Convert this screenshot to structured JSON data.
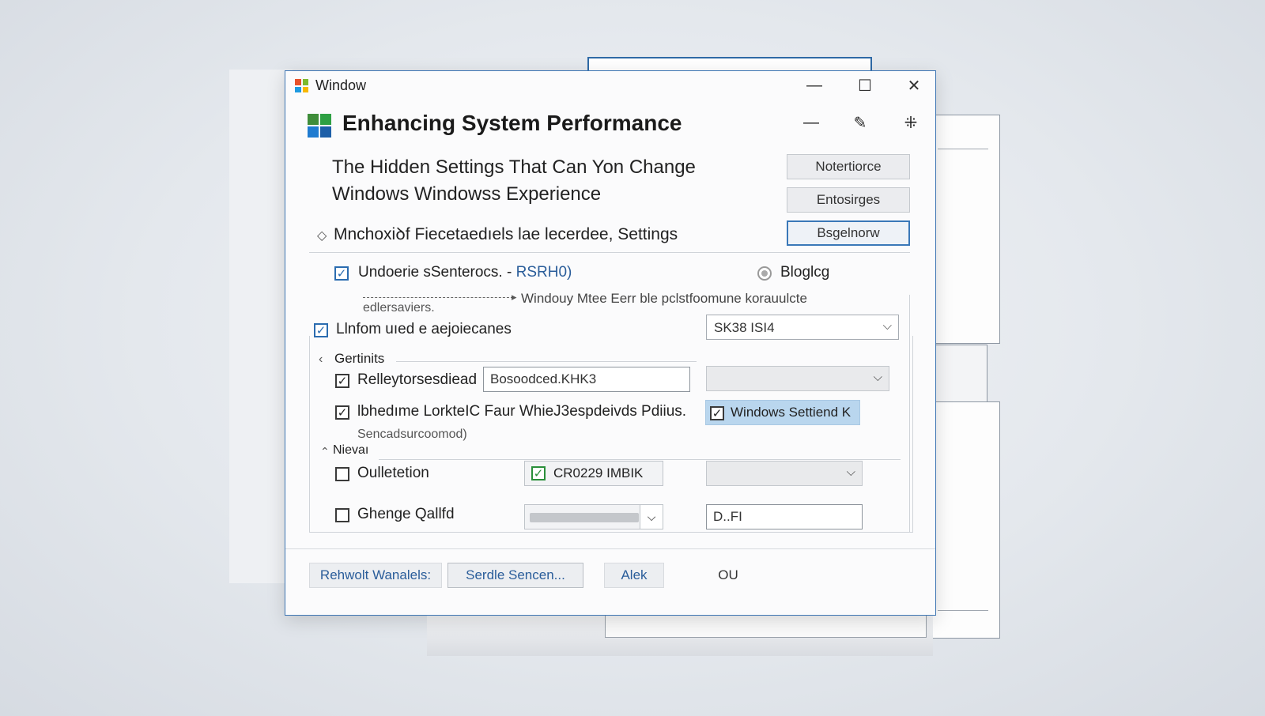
{
  "window": {
    "title": "Window",
    "controls": {
      "minimize": "—",
      "maximize": "☐",
      "close": "✕"
    }
  },
  "header": {
    "title": "Enhancing System Performance",
    "icons": [
      "minus-icon",
      "edit-icon",
      "settings-icon"
    ]
  },
  "intro": {
    "line1": "The Hidden Settings That Can Yon Change",
    "line2": "Windows Windowss Experience",
    "line3": "Mnchoxiꝺf Fiecetaedıels lae lecerdee, Settings"
  },
  "side_buttons": [
    "Notertiorce",
    "Entosirges",
    "Bsgelnorw"
  ],
  "options": {
    "option1": {
      "label": "Undoerie sSenterocs. -",
      "value": "RSRH0)",
      "checked": true
    },
    "radio": {
      "label": "Bloglcg"
    },
    "arrow_note": "Windouy Mtee Eerr ble pclstfoomune korauulcte",
    "arrow_sub": "edlersaviers.",
    "option2": {
      "label": "Llnfom uıed e aejoiecanes",
      "checked": true
    },
    "dropdown1": "SK38 ISI4"
  },
  "group1": {
    "title": "Gertinits",
    "item1": {
      "label": "Relleytorsesdiead",
      "input_value": "Bosoodced.KHK3",
      "checked": true
    },
    "item2": {
      "label": "lbhedıme LorkteIC Faur WhieJ3espdeivds Pdiius.",
      "checked": true
    },
    "item2_sub": "Sencadsurcoomod)",
    "highlight": {
      "label": "Windows Settiend K",
      "checked": true
    }
  },
  "group2": {
    "title": "Nievaı",
    "item1": {
      "label": "Oulletetion",
      "checked": false,
      "chip": "CR0229 IMBIK",
      "chip_checked": true
    },
    "item2": {
      "label": "Ghenge Qallfd",
      "checked": false,
      "input_value": "D..FI"
    }
  },
  "footer": {
    "buttons": [
      "Rehwolt Wanalels:",
      "Serdle Sencen...",
      "Alek",
      "OU"
    ]
  }
}
